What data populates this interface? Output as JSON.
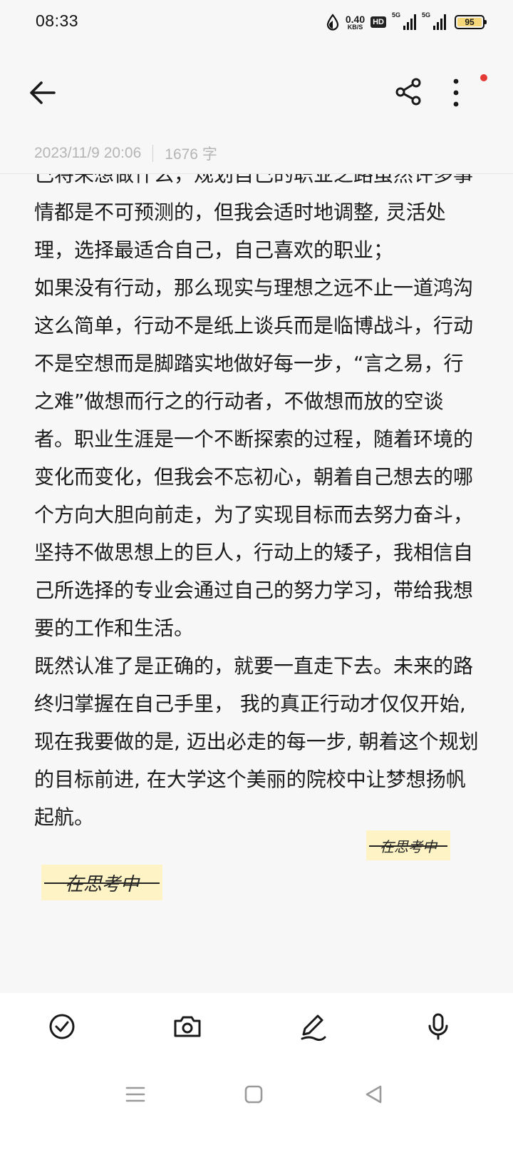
{
  "status_bar": {
    "time": "08:33",
    "net_speed_value": "0.40",
    "net_speed_unit": "KB/S",
    "hd_badge": "HD",
    "signal1_label": "5G",
    "signal2_label": "5G",
    "battery_level": "95",
    "battery_fill_color": "#f5d77a"
  },
  "app_bar": {
    "back_icon": "arrow-left-icon",
    "share_icon": "share-icon",
    "more_icon": "more-vertical-icon",
    "notification_dot_color": "#e53935"
  },
  "note": {
    "date": "2023/11/9 20:06",
    "word_count": "1676 字",
    "paragraphs": [
      "己将来想做什么，规划自己的职业之路虽然许多事情都是不可预测的，但我会适时地调整, 灵活处理，选择最适合自己，自己喜欢的职业；",
      "如果没有行动，那么现实与理想之远不止一道鸿沟这么简单，行动不是纸上谈兵而是临博战斗，行动不是空想而是脚踏实地做好每一步，“言之易，行之难”做想而行之的行动者，不做想而放的空谈者。职业生涯是一个不断探索的过程，随着环境的变化而变化，但我会不忘初心，朝着自己想去的哪个方向大胆向前走，为了实现目标而去努力奋斗，坚持不做思想上的巨人，行动上的矮子，我相信自己所选择的专业会通过自己的努力学习，带给我想要的工作和生活。",
      "既然认准了是正确的，就要一直走下去。未来的路终归掌握在自己手里， 我的真正行动才仅仅开始, 现在我要做的是, 迈出必走的每一步, 朝着这个规划的目标前进, 在大学这个美丽的院校中让梦想扬帆起航。"
    ],
    "sticker_text": "在思考中",
    "sticker_color": "#fdf3c4"
  },
  "toolbar": {
    "check_icon": "checklist-icon",
    "camera_icon": "camera-icon",
    "pen_icon": "handwriting-pen-icon",
    "mic_icon": "microphone-icon"
  },
  "nav_bar": {
    "menu_icon": "recent-apps-icon",
    "home_icon": "home-icon",
    "back_icon": "back-triangle-icon"
  }
}
